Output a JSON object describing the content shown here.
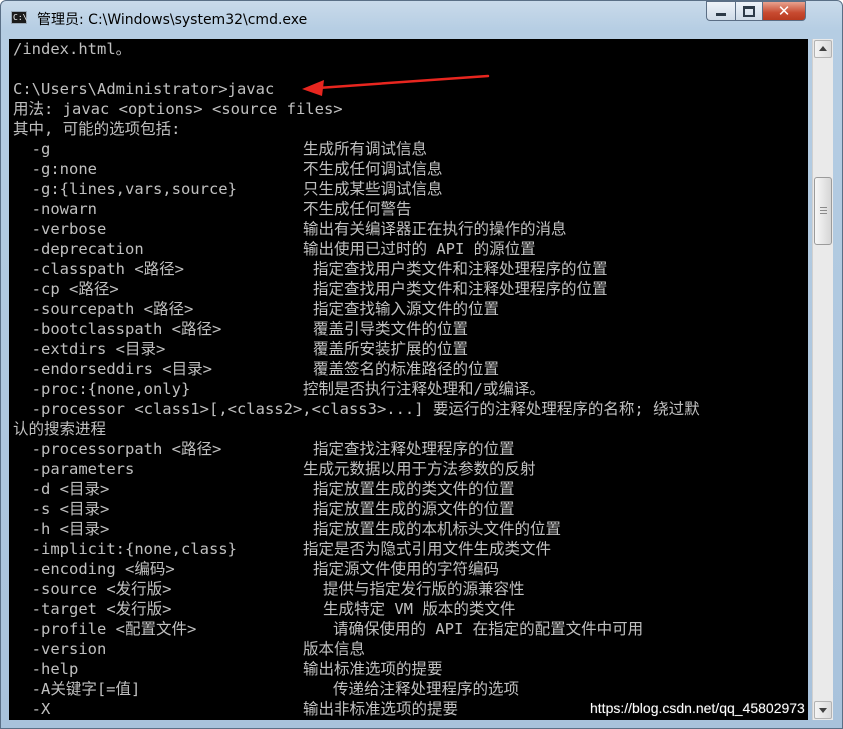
{
  "window": {
    "title": "管理员: C:\\Windows\\system32\\cmd.exe",
    "icon_label": "C:\\",
    "controls": {
      "minimize": "minimize-icon",
      "maximize": "maximize-icon",
      "close": "close-icon",
      "close_glyph": "✕"
    }
  },
  "console": {
    "lines": [
      "/index.html。",
      "",
      "C:\\Users\\Administrator>javac",
      "用法: javac <options> <source files>",
      "其中, 可能的选项包括:"
    ],
    "options": [
      {
        "flag": "  -g",
        "desc": "生成所有调试信息",
        "offset": 0
      },
      {
        "flag": "  -g:none",
        "desc": "不生成任何调试信息",
        "offset": 0
      },
      {
        "flag": "  -g:{lines,vars,source}",
        "desc": "只生成某些调试信息",
        "offset": 0
      },
      {
        "flag": "  -nowarn",
        "desc": "不生成任何警告",
        "offset": 0
      },
      {
        "flag": "  -verbose",
        "desc": "输出有关编译器正在执行的操作的消息",
        "offset": 0
      },
      {
        "flag": "  -deprecation",
        "desc": "输出使用已过时的 API 的源位置",
        "offset": 0
      },
      {
        "flag": "  -classpath <路径>",
        "desc": "指定查找用户类文件和注释处理程序的位置",
        "offset": 1
      },
      {
        "flag": "  -cp <路径>",
        "desc": "指定查找用户类文件和注释处理程序的位置",
        "offset": 1
      },
      {
        "flag": "  -sourcepath <路径>",
        "desc": "指定查找输入源文件的位置",
        "offset": 1
      },
      {
        "flag": "  -bootclasspath <路径>",
        "desc": "覆盖引导类文件的位置",
        "offset": 1
      },
      {
        "flag": "  -extdirs <目录>",
        "desc": "覆盖所安装扩展的位置",
        "offset": 1
      },
      {
        "flag": "  -endorseddirs <目录>",
        "desc": "覆盖签名的标准路径的位置",
        "offset": 1
      },
      {
        "flag": "  -proc:{none,only}",
        "desc": "控制是否执行注释处理和/或编译。",
        "offset": 0
      }
    ],
    "processor_line": "  -processor <class1>[,<class2>,<class3>...] 要运行的注释处理程序的名称; 绕过默",
    "processor_wrap": "认的搜索进程",
    "options2": [
      {
        "flag": "  -processorpath <路径>",
        "desc": "指定查找注释处理程序的位置",
        "offset": 1
      },
      {
        "flag": "  -parameters",
        "desc": "生成元数据以用于方法参数的反射",
        "offset": 0
      },
      {
        "flag": "  -d <目录>",
        "desc": "指定放置生成的类文件的位置",
        "offset": 1
      },
      {
        "flag": "  -s <目录>",
        "desc": "指定放置生成的源文件的位置",
        "offset": 1
      },
      {
        "flag": "  -h <目录>",
        "desc": "指定放置生成的本机标头文件的位置",
        "offset": 1
      },
      {
        "flag": "  -implicit:{none,class}",
        "desc": "指定是否为隐式引用文件生成类文件",
        "offset": 0
      },
      {
        "flag": "  -encoding <编码>",
        "desc": "指定源文件使用的字符编码",
        "offset": 1
      },
      {
        "flag": "  -source <发行版>",
        "desc": "提供与指定发行版的源兼容性",
        "offset": 2
      },
      {
        "flag": "  -target <发行版>",
        "desc": "生成特定 VM 版本的类文件",
        "offset": 2
      },
      {
        "flag": "  -profile <配置文件>",
        "desc": "请确保使用的 API 在指定的配置文件中可用",
        "offset": 3
      },
      {
        "flag": "  -version",
        "desc": "版本信息",
        "offset": 0
      },
      {
        "flag": "  -help",
        "desc": "输出标准选项的提要",
        "offset": 0
      },
      {
        "flag": "  -A关键字[=值]",
        "desc": "传递给注释处理程序的选项",
        "offset": 3
      },
      {
        "flag": "  -X",
        "desc": "输出非标准选项的提要",
        "offset": 0
      }
    ]
  },
  "annotation": {
    "arrow_color": "#e8261f",
    "arrow": "red-arrow-icon"
  },
  "watermark": "https://blog.csdn.net/qq_45802973"
}
